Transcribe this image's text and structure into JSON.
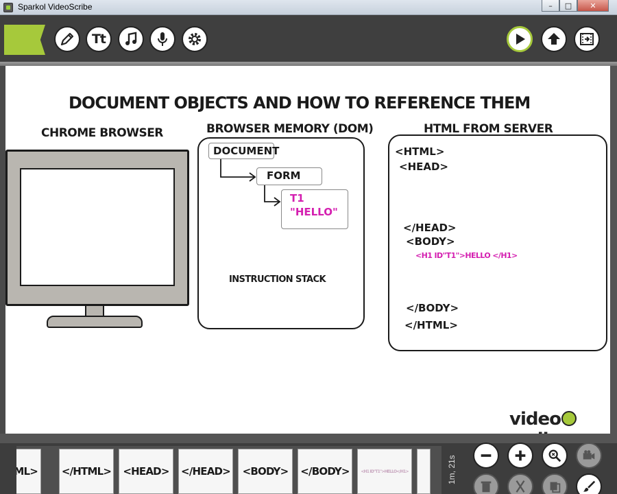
{
  "window": {
    "title": "Sparkol VideoScribe",
    "minimize": "–",
    "maximize": "□",
    "close": "✕"
  },
  "toolbar": {
    "left_tools": [
      "pencil-icon",
      "text-icon",
      "music-icon",
      "microphone-icon",
      "settings-icon"
    ],
    "text_tool_label": "Tt",
    "right_tools": [
      "play-icon",
      "upload-icon",
      "film-export-icon"
    ],
    "accent_color": "#a6c93b"
  },
  "canvas": {
    "title": "DOCUMENT OBJECTS AND HOW TO REFERENCE THEM",
    "chrome_label": "CHROME BROWSER",
    "dom_label": "BROWSER MEMORY (DOM)",
    "html_label": "HTML FROM SERVER",
    "dom_boxes": {
      "document": "DOCUMENT",
      "form": "FORM",
      "t1_line1": "T1",
      "t1_line2": "\"HELLO\""
    },
    "instruction_stack": "INSTRUCTION STACK",
    "html_code": {
      "line1": "<HTML>",
      "line2": "<HEAD>",
      "line3": "</HEAD>",
      "line4": "<BODY>",
      "line5": "<H1 ID\"T1\">HELLO </H1>",
      "line6": "</BODY>",
      "line7": "</HTML>"
    },
    "highlight_color": "#d41fb0",
    "logo": {
      "part1": "video",
      "part2": "scribe"
    }
  },
  "timeline": {
    "thumbs": [
      "ML>",
      "</HTML>",
      "<HEAD>",
      "</HEAD>",
      "<BODY>",
      "</BODY>",
      "<H1 ID\"T1\">HELLO</H1>"
    ],
    "duration": "1m, 21s"
  },
  "bottom_controls": [
    "zoom-out-icon",
    "zoom-in-icon",
    "zoom-fit-icon",
    "camera-icon",
    "trash-icon",
    "cut-icon",
    "copy-icon",
    "brush-icon"
  ]
}
